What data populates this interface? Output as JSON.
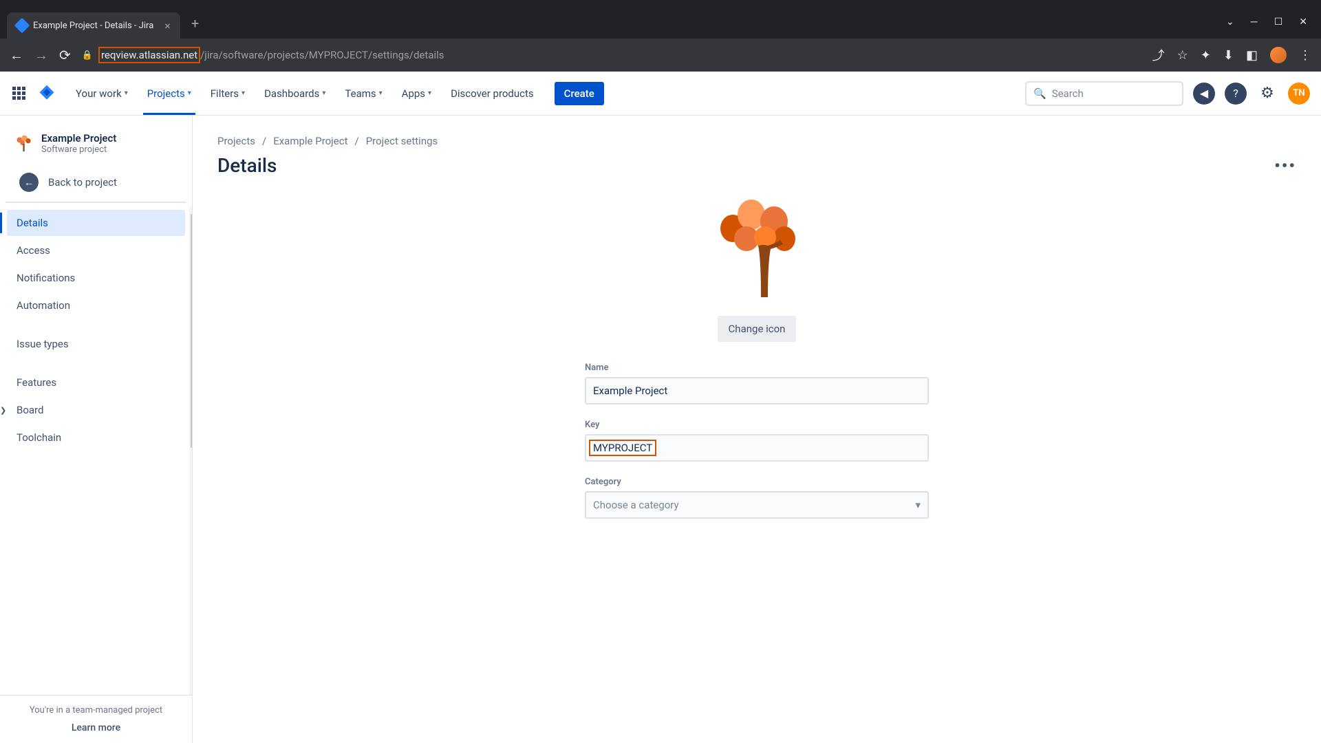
{
  "browser": {
    "tab_title": "Example Project - Details - Jira",
    "url_host": "reqview.atlassian.net",
    "url_path": "/jira/software/projects/MYPROJECT/settings/details"
  },
  "header": {
    "nav": {
      "your_work": "Your work",
      "projects": "Projects",
      "filters": "Filters",
      "dashboards": "Dashboards",
      "teams": "Teams",
      "apps": "Apps",
      "discover": "Discover products"
    },
    "create": "Create",
    "search_placeholder": "Search",
    "user_initials": "TN"
  },
  "sidebar": {
    "project_name": "Example Project",
    "project_type": "Software project",
    "back": "Back to project",
    "items": {
      "details": "Details",
      "access": "Access",
      "notifications": "Notifications",
      "automation": "Automation",
      "issue_types": "Issue types",
      "features": "Features",
      "board": "Board",
      "toolchain": "Toolchain"
    },
    "footer_text": "You're in a team-managed project",
    "learn_more": "Learn more"
  },
  "main": {
    "breadcrumb": {
      "projects": "Projects",
      "project": "Example Project",
      "settings": "Project settings"
    },
    "title": "Details",
    "change_icon": "Change icon",
    "fields": {
      "name_label": "Name",
      "name_value": "Example Project",
      "key_label": "Key",
      "key_value": "MYPROJECT",
      "category_label": "Category",
      "category_placeholder": "Choose a category"
    }
  }
}
